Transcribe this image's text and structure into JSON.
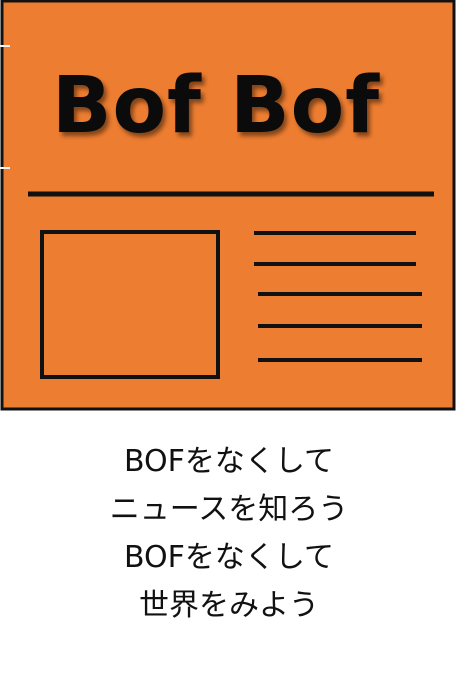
{
  "logo": {
    "title": "Bof Bof",
    "background_color": "#ED7D31",
    "line_color": "#111111",
    "icon": "newspaper-icon"
  },
  "caption": {
    "lines": [
      "BOFをなくして",
      "ニュースを知ろう",
      "BOFをなくして",
      "世界をみよう"
    ]
  }
}
